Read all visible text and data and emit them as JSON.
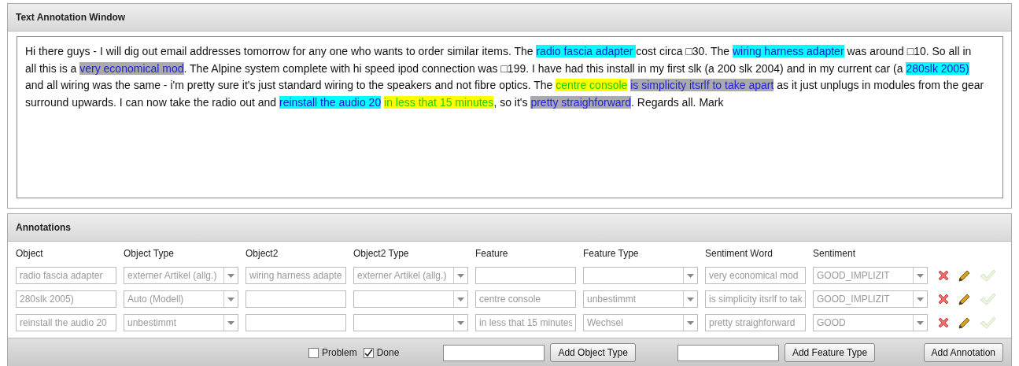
{
  "text_panel": {
    "title": "Text Annotation Window",
    "segments": [
      {
        "kind": "plain",
        "text": "Hi there guys - I will dig out email addresses tomorrow for any one who wants to order similar items. The "
      },
      {
        "kind": "object",
        "text": "radio fascia adapter "
      },
      {
        "kind": "plain",
        "text": "cost circa □30. The "
      },
      {
        "kind": "object",
        "text": "wiring harness adapter"
      },
      {
        "kind": "plain",
        "text": " was around □10. So all in all this is a "
      },
      {
        "kind": "sentiment",
        "text": "very economical mod"
      },
      {
        "kind": "plain",
        "text": ". The Alpine system complete with hi speed ipod connection was □199. I have had this install in my first slk (a 200 slk 2004) and in my current car (a "
      },
      {
        "kind": "object",
        "text": "280slk 2005)"
      },
      {
        "kind": "plain",
        "text": " and all wiring was the same - i'm pretty sure it's just standard wiring to the speakers and not fibre optics. The "
      },
      {
        "kind": "feature",
        "text": "centre console"
      },
      {
        "kind": "sentiment",
        "text": "is simplicity itsrlf to take apart"
      },
      {
        "kind": "plain",
        "text": " as it just unplugs in modules from the gear surround upwards. I can now take the radio out and "
      },
      {
        "kind": "object",
        "text": "reinstall the audio 20"
      },
      {
        "kind": "feature",
        "text": "in less that 15 minutes"
      },
      {
        "kind": "plain",
        "text": ", so it's "
      },
      {
        "kind": "sentiment",
        "text": "pretty straighforward"
      },
      {
        "kind": "plain",
        "text": ". Regards all. Mark"
      }
    ]
  },
  "annotations": {
    "title": "Annotations",
    "columns": [
      "Object",
      "Object Type",
      "Object2",
      "Object2 Type",
      "Feature",
      "Feature Type",
      "Sentiment Word",
      "Sentiment"
    ],
    "rows": [
      {
        "object": "radio fascia adapter",
        "object_type": "externer Artikel (allg.)",
        "object2": "wiring harness adapte",
        "object2_type": "externer Artikel (allg.)",
        "sentiment_word": "very economical mod",
        "sentiment": "GOOD_IMPLIZIT"
      },
      {
        "object": "280slk 2005)",
        "object_type": "Auto (Modell)",
        "feature": "centre console",
        "feature_type": "unbestimmt",
        "sentiment_word": "is simplicity itsrlf to tak",
        "sentiment": "GOOD_IMPLIZIT"
      },
      {
        "object": "reinstall the audio 20",
        "object_type": "unbestimmt",
        "feature": "in less that 15 minutes",
        "feature_type": "Wechsel",
        "sentiment_word": "pretty straighforward",
        "sentiment": "GOOD"
      }
    ],
    "footer": {
      "checkboxes": [
        {
          "label": "Problem",
          "checked": false
        },
        {
          "label": "Done",
          "checked": true
        }
      ],
      "buttons": [
        "Add Object Type",
        "Add Feature Type",
        "Add Annotation"
      ]
    }
  }
}
